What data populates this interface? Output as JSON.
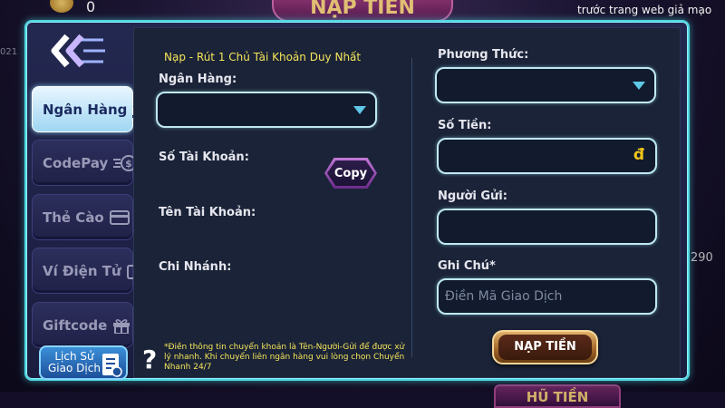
{
  "background": {
    "coin_value": "0",
    "title_banner": "NẠP TIỀN",
    "ticker_text": "trước trang web giả mạo",
    "left_number": "021",
    "right_number": "290",
    "bottom_banner": "HŨ TIỀN"
  },
  "sidebar": {
    "tabs": [
      {
        "label": "Ngân Hàng",
        "icon": "bank-icon",
        "active": true
      },
      {
        "label": "CodePay",
        "icon": "coin-transfer-icon",
        "active": false
      },
      {
        "label": "Thẻ Cào",
        "icon": "card-icon",
        "active": false
      },
      {
        "label": "Ví Điện Tử",
        "icon": "wallet-icon",
        "active": false
      },
      {
        "label": "Giftcode",
        "icon": "gift-icon",
        "active": false
      }
    ],
    "history": {
      "line1": "Lịch Sử",
      "line2": "Giao Dịch",
      "icon": "receipt-icon"
    }
  },
  "form": {
    "notice": "Nạp - Rút 1 Chủ Tài Khoản Duy Nhất",
    "bank_label": "Ngân Hàng:",
    "bank_value": "",
    "account_number_label": "Số Tài Khoản:",
    "copy_label": "Copy",
    "account_name_label": "Tên Tài Khoản:",
    "branch_label": "Chi Nhánh:",
    "method_label": "Phương Thức:",
    "method_value": "",
    "amount_label": "Số Tiền:",
    "amount_currency": "đ",
    "sender_label": "Người Gửi:",
    "note_label": "Ghi Chú*",
    "note_placeholder": "Điền Mã Giao Dịch",
    "footnote": "*Điền thông tin chuyển khoản là Tên-Người-Gửi để được xử lý nhanh. Khi chuyển liên ngân hàng vui lòng chọn Chuyển Nhanh 24/7",
    "submit_label": "NẠP TIỀN"
  },
  "colors": {
    "accent_cyan": "#4fd7e0",
    "notice_yellow": "#f5e55a",
    "active_tab": "#e8f6ff",
    "copy_purple": "#6a2a8a",
    "submit_gold": "#e2b36a"
  }
}
